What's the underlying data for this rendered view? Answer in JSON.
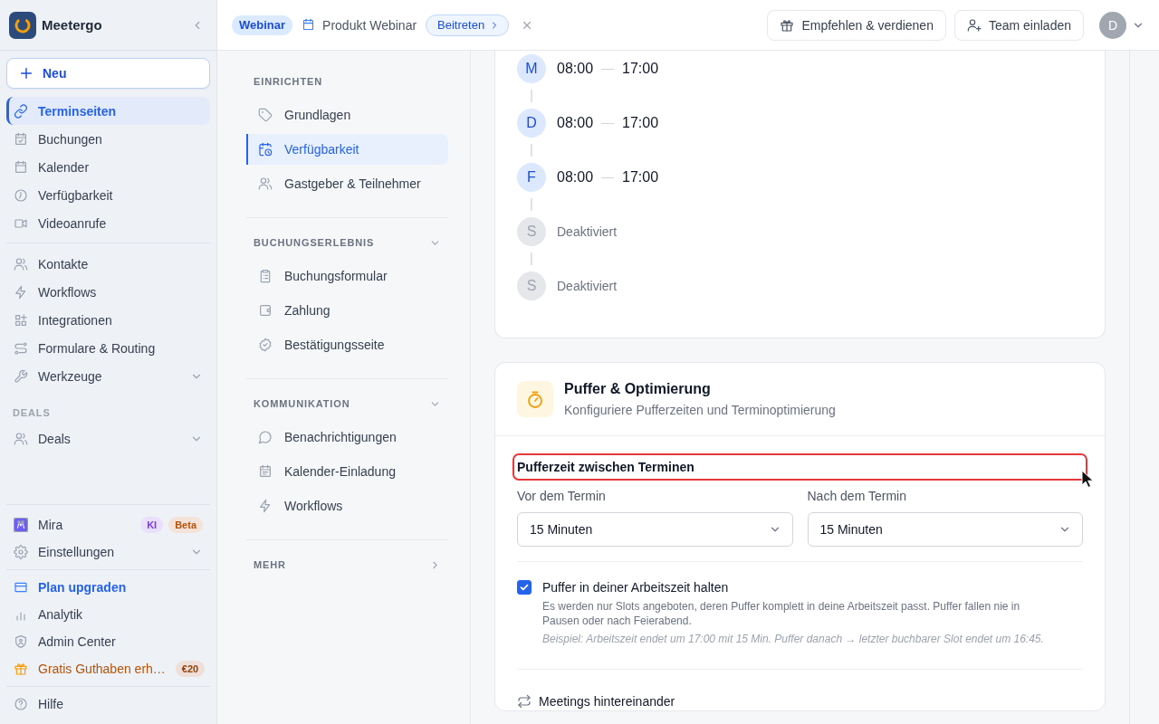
{
  "sidebar": {
    "brand": "Meetergo",
    "new_button": "Neu",
    "sections": [
      {
        "items": [
          {
            "kind": "link",
            "label": "Terminseiten",
            "selected": true
          },
          {
            "kind": "link",
            "label": "Buchungen",
            "selected": false
          },
          {
            "kind": "link",
            "label": "Kalender",
            "selected": false
          },
          {
            "kind": "link",
            "label": "Verfügbarkeit",
            "selected": false
          },
          {
            "kind": "link",
            "label": "Videoanrufe",
            "selected": false
          }
        ]
      },
      {
        "items": [
          {
            "kind": "link",
            "label": "Kontakte",
            "selected": false
          },
          {
            "kind": "link",
            "label": "Workflows",
            "selected": false
          },
          {
            "kind": "link",
            "label": "Integrationen",
            "selected": false
          },
          {
            "kind": "link",
            "label": "Formulare & Routing",
            "selected": false
          },
          {
            "kind": "menu",
            "label": "Werkzeuge",
            "selected": false,
            "expanded": false
          }
        ]
      },
      {
        "heading": "DEALS",
        "items": [
          {
            "kind": "menu",
            "label": "Deals",
            "selected": false,
            "expanded": false
          }
        ]
      }
    ],
    "footer_sections": [
      {
        "items": [
          {
            "kind": "assistant",
            "label": "Mira",
            "selected": false,
            "badges": [
              {
                "text": "KI",
                "color": "#7c3aed"
              },
              {
                "text": "Beta",
                "color": "#b45309"
              }
            ]
          },
          {
            "kind": "menu",
            "label": "Einstellungen",
            "selected": false,
            "expanded": false
          }
        ]
      },
      {
        "items": [
          {
            "kind": "upgrade",
            "label": "Plan upgraden",
            "selected": false
          },
          {
            "kind": "link",
            "label": "Analytik",
            "selected": false
          },
          {
            "kind": "link",
            "label": "Admin Center",
            "selected": false
          },
          {
            "kind": "promo",
            "label": "Gratis Guthaben erh…",
            "selected": false,
            "badges": [
              {
                "text": "€20",
                "color": "#92400e"
              }
            ]
          }
        ]
      },
      {
        "items": [
          {
            "kind": "link",
            "label": "Hilfe",
            "selected": false
          }
        ]
      }
    ]
  },
  "topbar": {
    "event_type": "Webinar",
    "event_name": "Produkt Webinar",
    "join_button": "Beitreten",
    "refer_button": "Empfehlen & verdienen",
    "invite_button": "Team einladen",
    "avatar": "D"
  },
  "settings_nav": {
    "sections": [
      {
        "kind": "fixed",
        "heading": "EINRICHTEN",
        "items": [
          {
            "label": "Grundlagen",
            "selected": false
          },
          {
            "label": "Verfügbarkeit",
            "selected": true
          },
          {
            "label": "Gastgeber & Teilnehmer",
            "selected": false
          }
        ]
      },
      {
        "kind": "collapsible",
        "heading": "BUCHUNGSERLEBNIS",
        "expanded": true,
        "items": [
          {
            "label": "Buchungsformular",
            "selected": false
          },
          {
            "label": "Zahlung",
            "selected": false
          },
          {
            "label": "Bestätigungsseite",
            "selected": false
          }
        ]
      },
      {
        "kind": "collapsible",
        "heading": "KOMMUNIKATION",
        "expanded": true,
        "items": [
          {
            "label": "Benachrichtigungen",
            "selected": false
          },
          {
            "label": "Kalender-Einladung",
            "selected": false
          },
          {
            "label": "Workflows",
            "selected": false
          }
        ]
      },
      {
        "kind": "collapsible",
        "heading": "MEHR",
        "expanded": false
      }
    ]
  },
  "weekly_schedule": {
    "days": [
      {
        "letter": "M",
        "enabled": true,
        "start": "08:00",
        "end": "17:00"
      },
      {
        "letter": "D",
        "enabled": true,
        "start": "08:00",
        "end": "17:00"
      },
      {
        "letter": "F",
        "enabled": true,
        "start": "08:00",
        "end": "17:00"
      },
      {
        "letter": "S",
        "enabled": false,
        "status": "Deaktiviert"
      },
      {
        "letter": "S",
        "enabled": false,
        "status": "Deaktiviert"
      }
    ]
  },
  "buffer_card": {
    "title": "Puffer & Optimierung",
    "subtitle": "Konfiguriere Pufferzeiten und Terminoptimierung",
    "buffer_section": {
      "label": "Pufferzeit zwischen Terminen",
      "highlighted": true
    },
    "selects": [
      {
        "label": "Vor dem Termin",
        "value": "15 Minuten"
      },
      {
        "label": "Nach dem Termin",
        "value": "15 Minuten"
      }
    ],
    "option": {
      "label": "Puffer in deiner Arbeitszeit halten",
      "checked": true,
      "description": "Es werden nur Slots angeboten, deren Puffer komplett in deine Arbeitszeit passt. Puffer fallen nie in Pausen oder nach Feierabend.",
      "example": "Beispiel: Arbeitszeit endet um 17:00 mit 15 Min. Puffer danach → letzter buchbarer Slot endet um 16:45."
    },
    "back_to_back": {
      "label": "Meetings hintereinander"
    }
  }
}
